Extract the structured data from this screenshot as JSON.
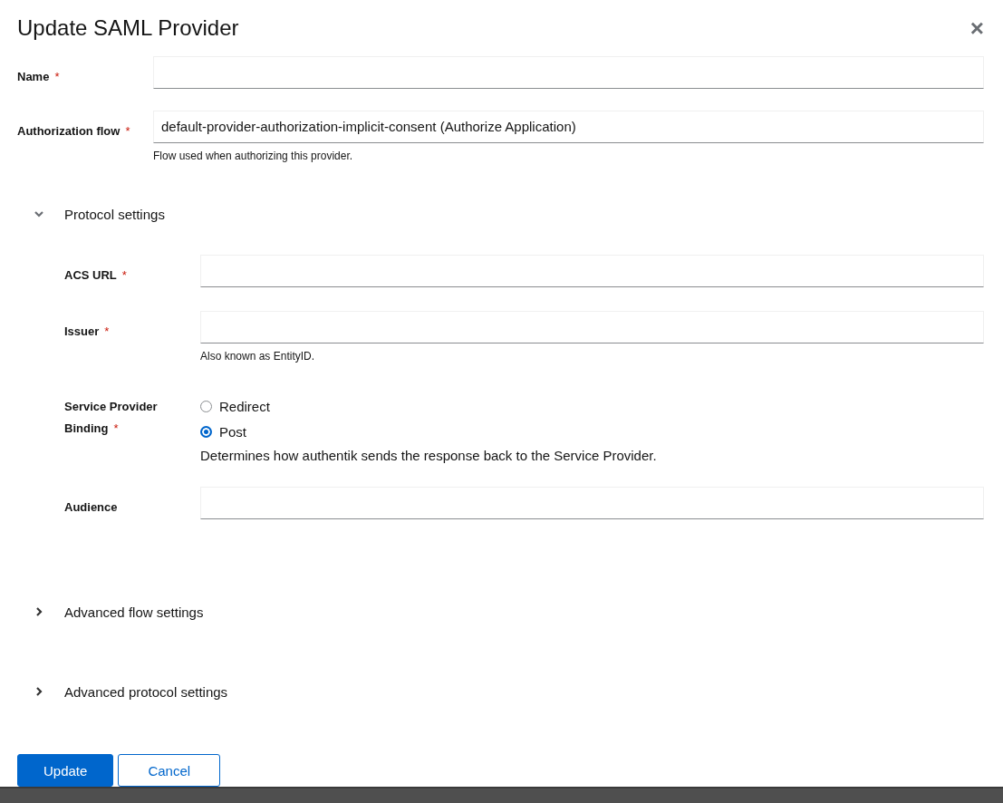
{
  "dialog": {
    "title": "Update SAML Provider",
    "close": "×"
  },
  "fields": [
    {
      "kind": "text",
      "label": "Name",
      "required_mark": "*"
    },
    {
      "kind": "text",
      "label": "Authorization flow",
      "required_mark": "*",
      "value": "default-provider-authorization-implicit-consent (Authorize Application)",
      "helper": "Flow used when authorizing this provider."
    }
  ],
  "sections": [
    {
      "title": "Protocol settings",
      "expanded": true,
      "fields": [
        {
          "kind": "text",
          "label": "ACS URL",
          "required_mark": "*"
        },
        {
          "kind": "text",
          "label": "Issuer",
          "required_mark": "*",
          "helper": "Also known as EntityID."
        },
        {
          "kind": "radio",
          "label": "Service Provider Binding",
          "required_mark": "*",
          "options": [
            {
              "label": "Redirect",
              "selected": false
            },
            {
              "label": "Post",
              "selected": true
            }
          ],
          "helper": "Determines how authentik sends the response back to the Service Provider."
        },
        {
          "kind": "text",
          "label": "Audience"
        }
      ]
    },
    {
      "title": "Advanced flow settings",
      "expanded": false
    },
    {
      "title": "Advanced protocol settings",
      "expanded": false
    }
  ],
  "buttons": [
    {
      "kind": "primary",
      "label": "Update"
    },
    {
      "kind": "secondary",
      "label": "Cancel"
    }
  ]
}
